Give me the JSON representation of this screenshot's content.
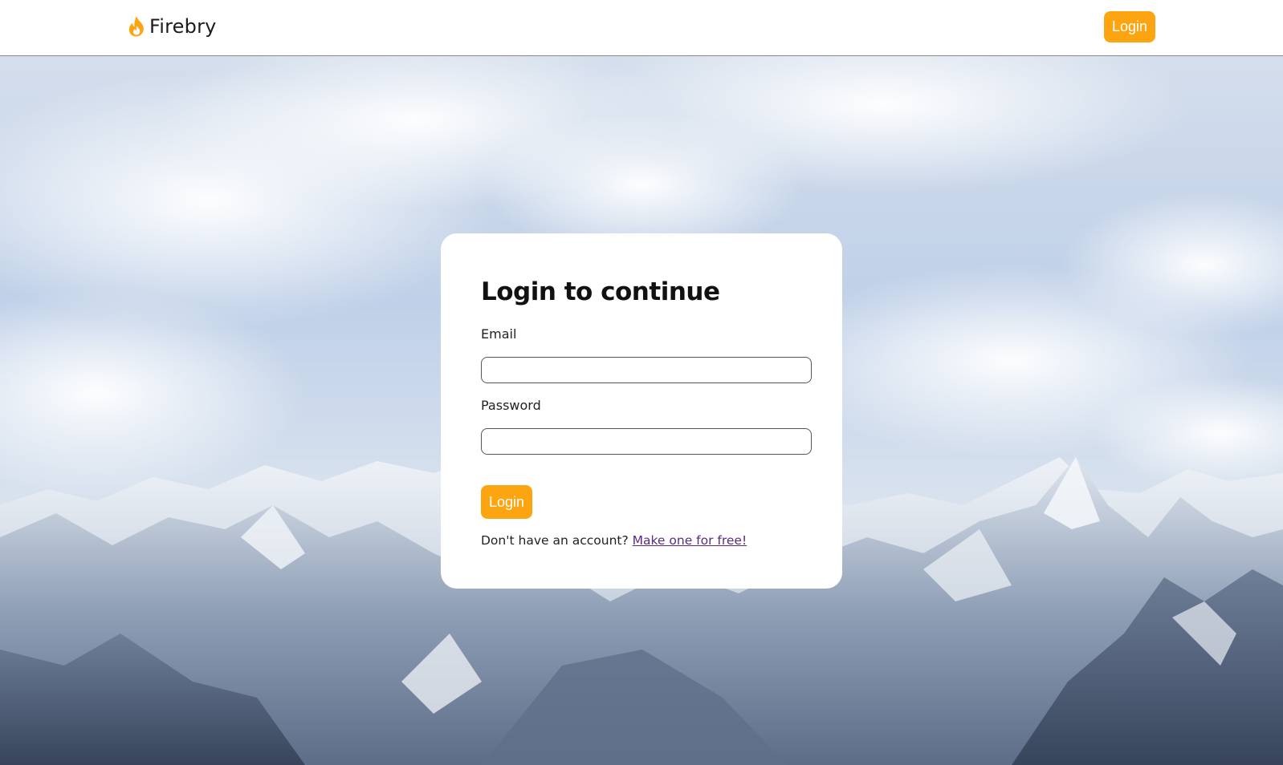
{
  "navbar": {
    "brand_name": "Firebry",
    "login_label": "Login"
  },
  "login_form": {
    "title": "Login to continue",
    "email_label": "Email",
    "email_value": "",
    "password_label": "Password",
    "password_value": "",
    "submit_label": "Login",
    "signup_prompt": "Don't have an account?",
    "signup_link": "Make one for free!"
  },
  "colors": {
    "accent": "#fca510",
    "link": "#5a2a82"
  },
  "icons": {
    "brand": "flame-icon"
  }
}
